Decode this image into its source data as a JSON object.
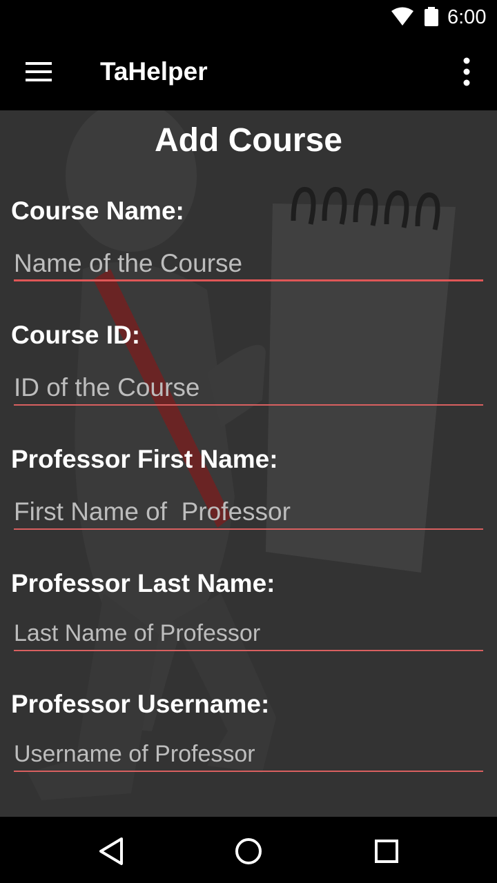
{
  "status_bar": {
    "time": "6:00",
    "icons": [
      "wifi-icon",
      "battery-icon"
    ]
  },
  "app_bar": {
    "title": "TaHelper",
    "menu_icon": "hamburger-menu-icon",
    "overflow_icon": "more-vert-icon"
  },
  "form": {
    "title": "Add Course",
    "fields": [
      {
        "label": "Course Name:",
        "placeholder": "Name of the Course",
        "value": ""
      },
      {
        "label": "Course ID:",
        "placeholder": "ID of the Course",
        "value": ""
      },
      {
        "label": "Professor First Name:",
        "placeholder": "First Name of  Professor",
        "value": ""
      },
      {
        "label": "Professor Last Name:",
        "placeholder": "Last Name of Professor",
        "value": ""
      },
      {
        "label": "Professor Username:",
        "placeholder": "Username of Professor",
        "value": ""
      }
    ]
  },
  "nav_bar": {
    "icons": [
      "back-triangle-icon",
      "home-circle-icon",
      "recents-square-icon"
    ]
  },
  "colors": {
    "accent": "#e05757",
    "background": "#333333",
    "bars": "#000000"
  }
}
